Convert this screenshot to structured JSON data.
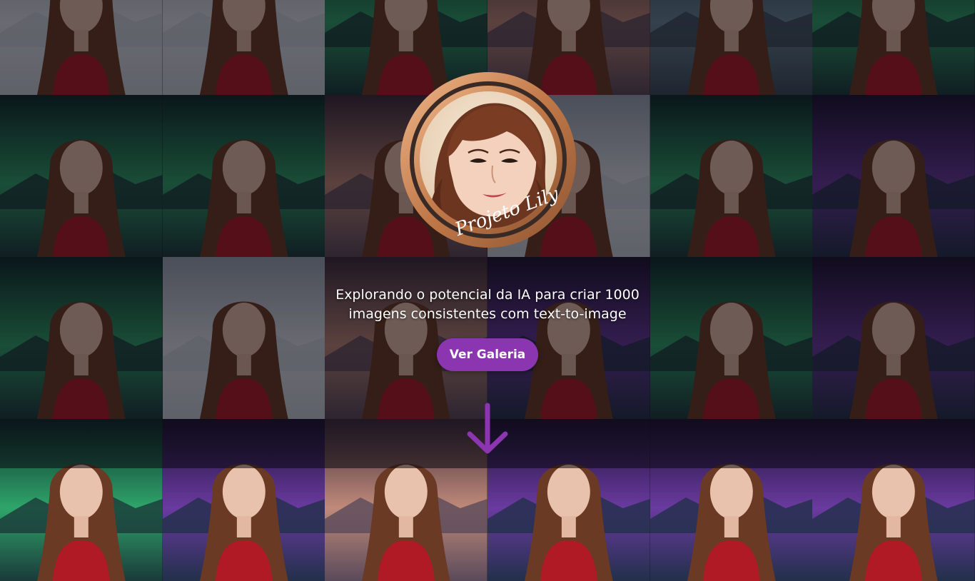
{
  "logo": {
    "signature": "Projeto Lily"
  },
  "hero": {
    "tagline_line1": "Explorando o potencial da IA para criar 1000",
    "tagline_line2": "imagens consistentes com text-to-image",
    "cta_label": "Ver Galeria"
  },
  "icons": {
    "scroll": "arrow-down-icon"
  },
  "colors": {
    "accent": "#8b36b0",
    "logo_ring": "#c98a5a",
    "overlay": "#0a080e"
  },
  "gallery": {
    "tiles": [
      {
        "bg": "snow"
      },
      {
        "bg": "snow"
      },
      {
        "bg": "aurora-green"
      },
      {
        "bg": "dusk"
      },
      {
        "bg": "lake"
      },
      {
        "bg": "aurora-green"
      },
      {
        "bg": "aurora-green"
      },
      {
        "bg": "aurora-green"
      },
      {
        "bg": "dusk"
      },
      {
        "bg": "snow"
      },
      {
        "bg": "aurora-green"
      },
      {
        "bg": "aurora-purple"
      },
      {
        "bg": "aurora-green"
      },
      {
        "bg": "snow"
      },
      {
        "bg": "dusk"
      },
      {
        "bg": "aurora-purple"
      },
      {
        "bg": "aurora-green"
      },
      {
        "bg": "aurora-purple"
      },
      {
        "bg": "aurora-green"
      },
      {
        "bg": "aurora-purple"
      },
      {
        "bg": "dusk"
      },
      {
        "bg": "aurora-purple"
      },
      {
        "bg": "aurora-purple"
      },
      {
        "bg": "aurora-purple"
      }
    ]
  }
}
